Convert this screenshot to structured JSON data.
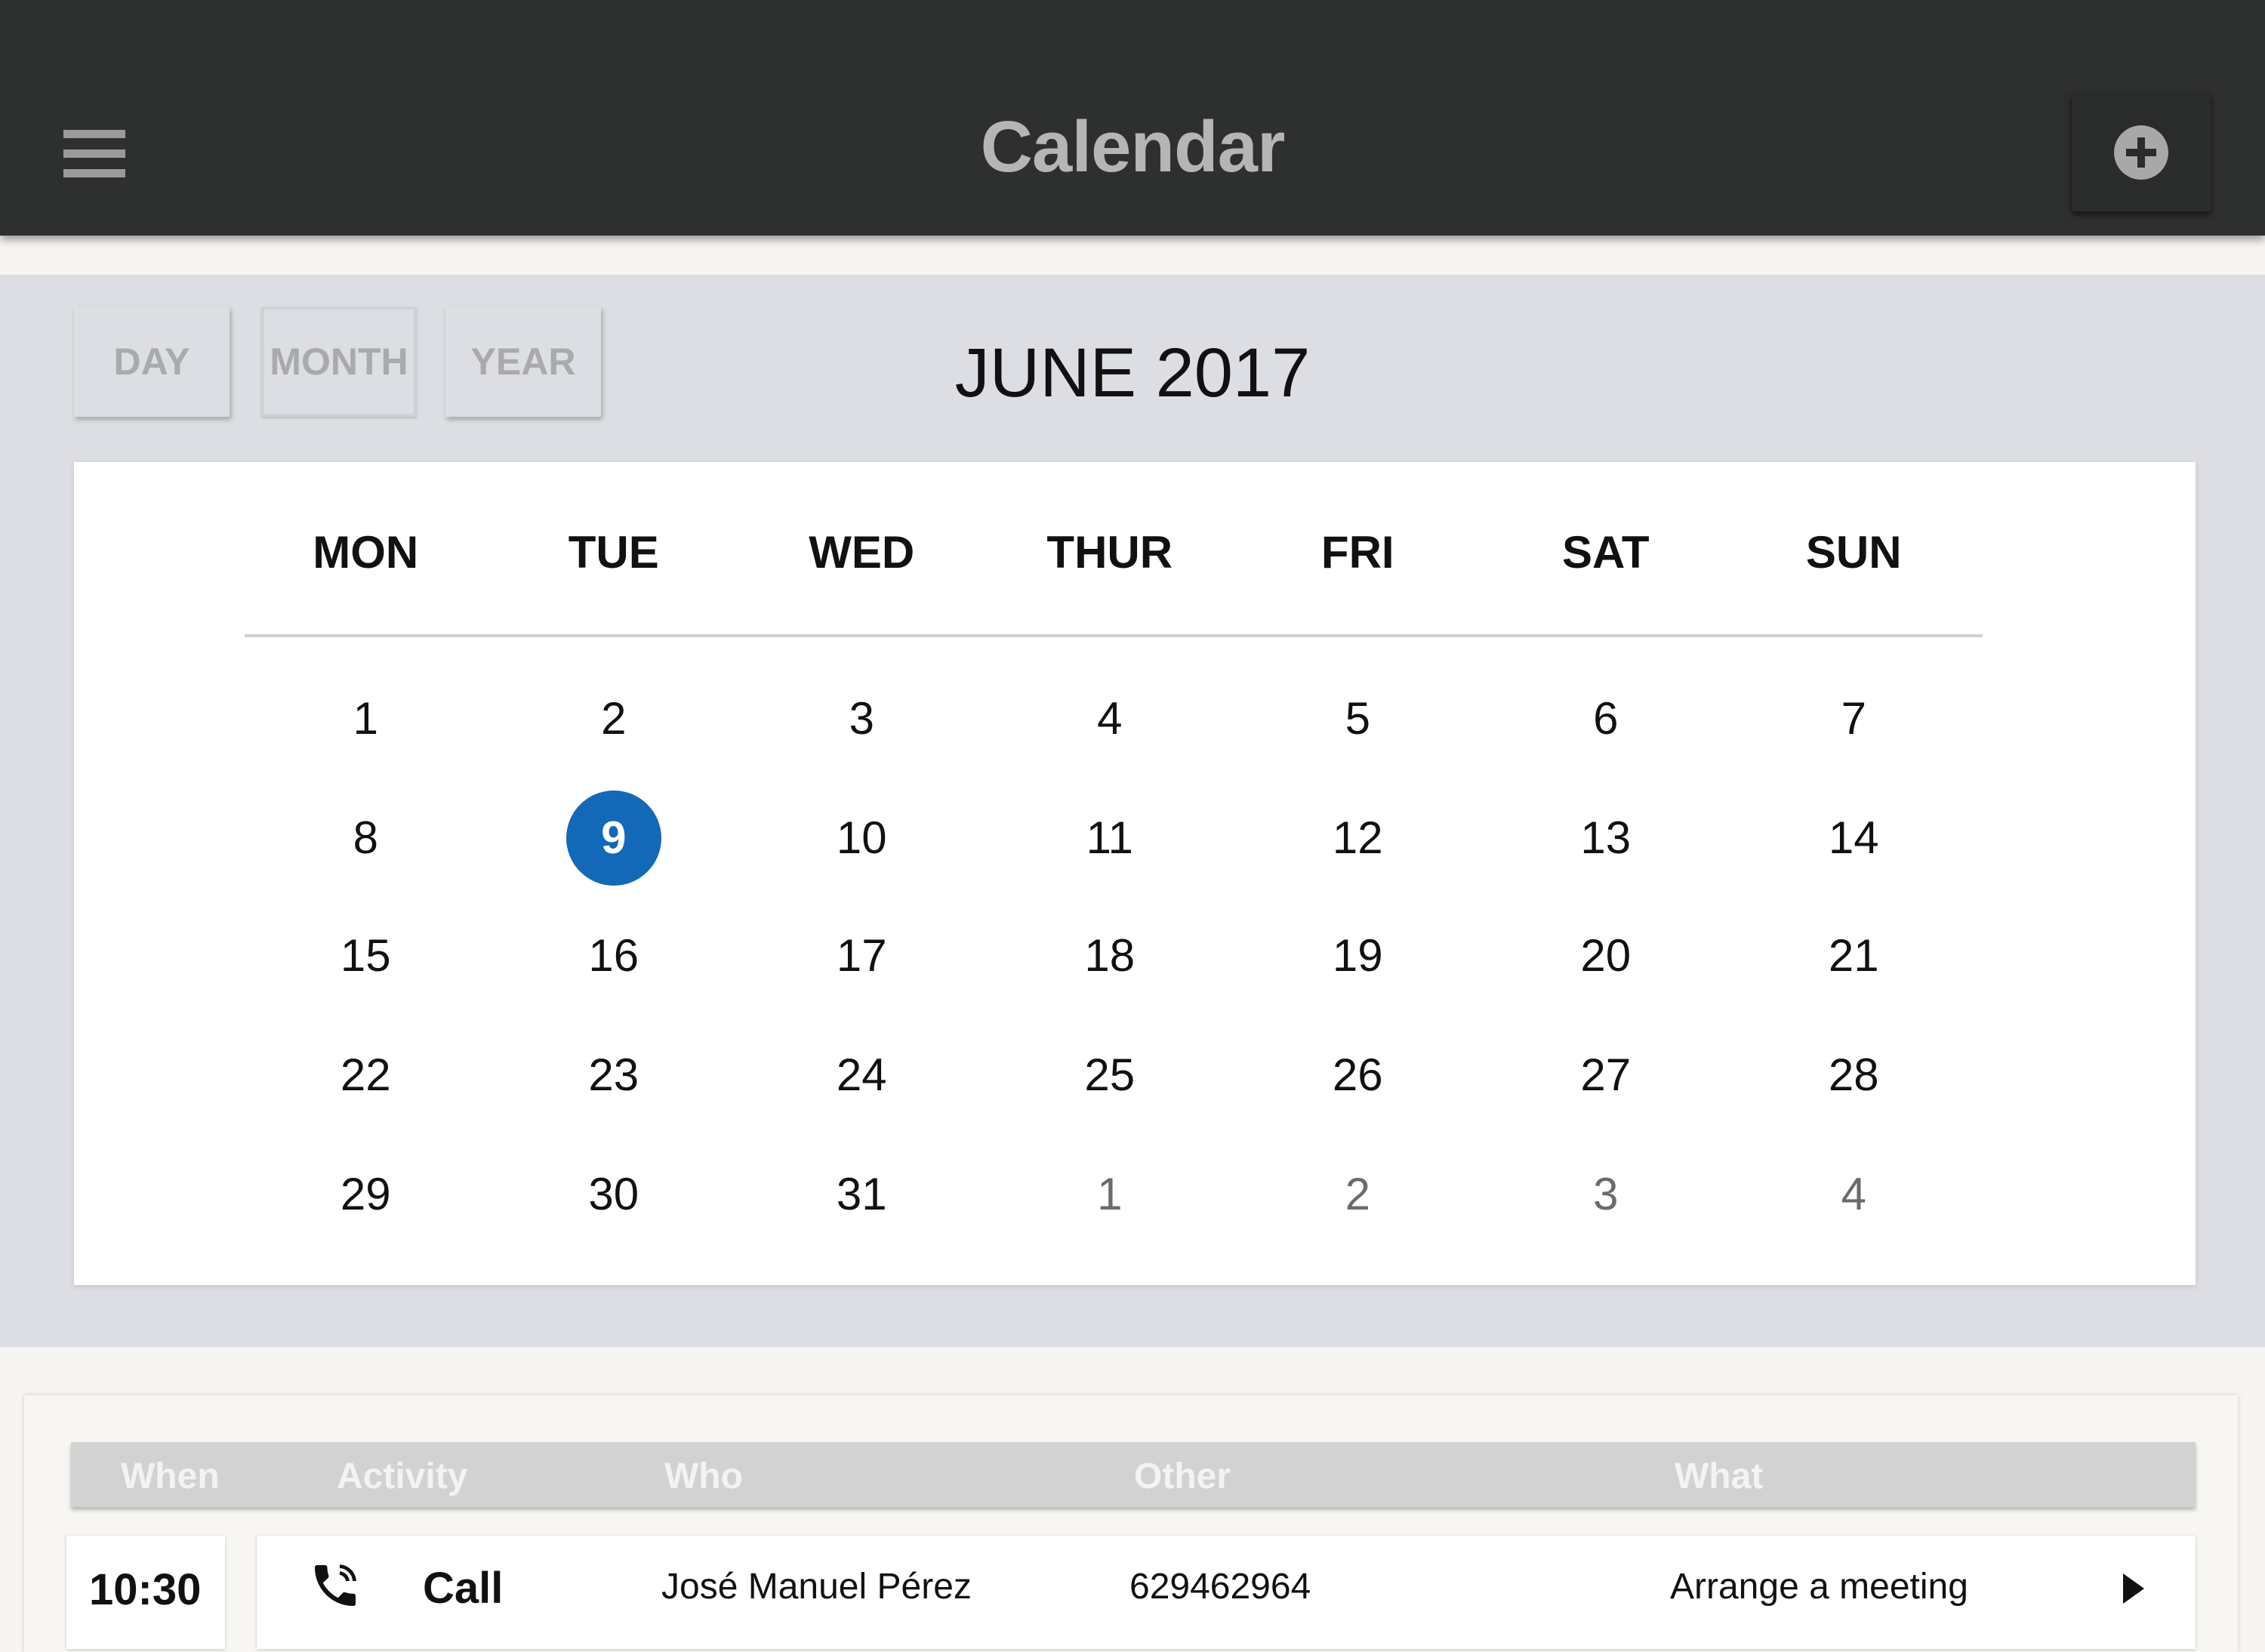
{
  "header": {
    "title": "Calendar"
  },
  "views": {
    "day": "DAY",
    "month": "MONTH",
    "year": "YEAR"
  },
  "calendar": {
    "month_title": "JUNE 2017",
    "weekdays": [
      "MON",
      "TUE",
      "WED",
      "THUR",
      "FRI",
      "SAT",
      "SUN"
    ],
    "weeks": [
      [
        "1",
        "2",
        "3",
        "4",
        "5",
        "6",
        "7"
      ],
      [
        "8",
        "9",
        "10",
        "11",
        "12",
        "13",
        "14"
      ],
      [
        "15",
        "16",
        "17",
        "18",
        "19",
        "20",
        "21"
      ],
      [
        "22",
        "23",
        "24",
        "25",
        "26",
        "27",
        "28"
      ],
      [
        "29",
        "30",
        "31",
        "1",
        "2",
        "3",
        "4"
      ]
    ],
    "selected_day": "9",
    "accent_color": "#1368b8"
  },
  "agenda": {
    "columns": {
      "when": "When",
      "activity": "Activity",
      "who": "Who",
      "other": "Other",
      "what": "What"
    },
    "rows": [
      {
        "when": "10:30",
        "icon": "phone-icon",
        "activity": "Call",
        "who": "José Manuel Pérez",
        "other": "629462964",
        "what": "Arrange a meeting"
      }
    ]
  }
}
